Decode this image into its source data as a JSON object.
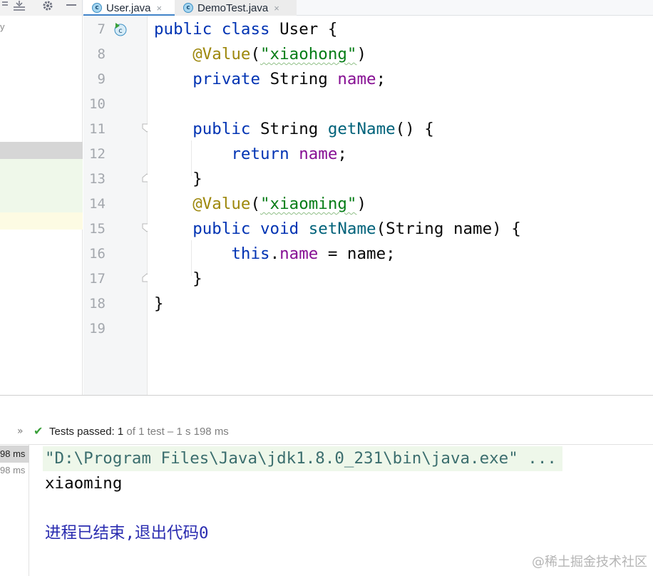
{
  "tabs": [
    {
      "label": "User.java",
      "close": "×",
      "active": true
    },
    {
      "label": "DemoTest.java",
      "close": "×",
      "active": false
    }
  ],
  "tab_icon_letter": "c",
  "toolbar_icons": [
    "collapse-icon",
    "settings-icon",
    "minimize-icon"
  ],
  "left_panel": {
    "partial_text": "y"
  },
  "editor": {
    "line_numbers": [
      "7",
      "8",
      "9",
      "10",
      "11",
      "12",
      "13",
      "14",
      "15",
      "16",
      "17",
      "18",
      "19"
    ],
    "lines": [
      [
        {
          "t": "public ",
          "c": "kw"
        },
        {
          "t": "class ",
          "c": "kw"
        },
        {
          "t": "User {",
          "c": "plain"
        }
      ],
      [
        {
          "t": "    ",
          "c": "plain"
        },
        {
          "t": "@Value",
          "c": "ann"
        },
        {
          "t": "(",
          "c": "plain"
        },
        {
          "t": "\"xiaohong\"",
          "c": "str wavy"
        },
        {
          "t": ")",
          "c": "plain"
        }
      ],
      [
        {
          "t": "    ",
          "c": "plain"
        },
        {
          "t": "private ",
          "c": "kw"
        },
        {
          "t": "String ",
          "c": "plain"
        },
        {
          "t": "name",
          "c": "fld"
        },
        {
          "t": ";",
          "c": "plain"
        }
      ],
      [],
      [
        {
          "t": "    ",
          "c": "plain"
        },
        {
          "t": "public ",
          "c": "kw"
        },
        {
          "t": "String ",
          "c": "plain"
        },
        {
          "t": "getName",
          "c": "mth"
        },
        {
          "t": "() {",
          "c": "plain"
        }
      ],
      [
        {
          "t": "        ",
          "c": "plain"
        },
        {
          "t": "return ",
          "c": "kw"
        },
        {
          "t": "name",
          "c": "fld"
        },
        {
          "t": ";",
          "c": "plain"
        }
      ],
      [
        {
          "t": "    }",
          "c": "plain"
        }
      ],
      [
        {
          "t": "    ",
          "c": "plain"
        },
        {
          "t": "@Value",
          "c": "ann"
        },
        {
          "t": "(",
          "c": "plain"
        },
        {
          "t": "\"xiaoming\"",
          "c": "str wavy"
        },
        {
          "t": ")",
          "c": "plain"
        }
      ],
      [
        {
          "t": "    ",
          "c": "plain"
        },
        {
          "t": "public ",
          "c": "kw"
        },
        {
          "t": "void ",
          "c": "kw"
        },
        {
          "t": "setName",
          "c": "mth"
        },
        {
          "t": "(String name) {",
          "c": "plain"
        }
      ],
      [
        {
          "t": "        ",
          "c": "plain"
        },
        {
          "t": "this",
          "c": "kw"
        },
        {
          "t": ".",
          "c": "plain"
        },
        {
          "t": "name",
          "c": "fld"
        },
        {
          "t": " = name;",
          "c": "plain"
        }
      ],
      [
        {
          "t": "    }",
          "c": "plain"
        }
      ],
      [
        {
          "t": "}",
          "c": "plain"
        }
      ],
      []
    ]
  },
  "run": {
    "chevron": "»",
    "check": "✔",
    "status_label": "Tests passed: ",
    "status_count": "1",
    "status_detail": " of 1 test – 1 s 198 ms",
    "tree_times": [
      "98 ms",
      "98 ms"
    ],
    "console": {
      "command": "\"D:\\Program Files\\Java\\jdk1.8.0_231\\bin\\java.exe\" ...",
      "output": "xiaoming",
      "exit_message": "进程已结束,退出代码0"
    }
  },
  "watermark": "@稀土掘金技术社区",
  "colors": {
    "keyword": "#0033b3",
    "annotation": "#9e880d",
    "string": "#067d17",
    "field": "#871094",
    "method": "#00627a",
    "test_passed": "#3aa03a"
  }
}
